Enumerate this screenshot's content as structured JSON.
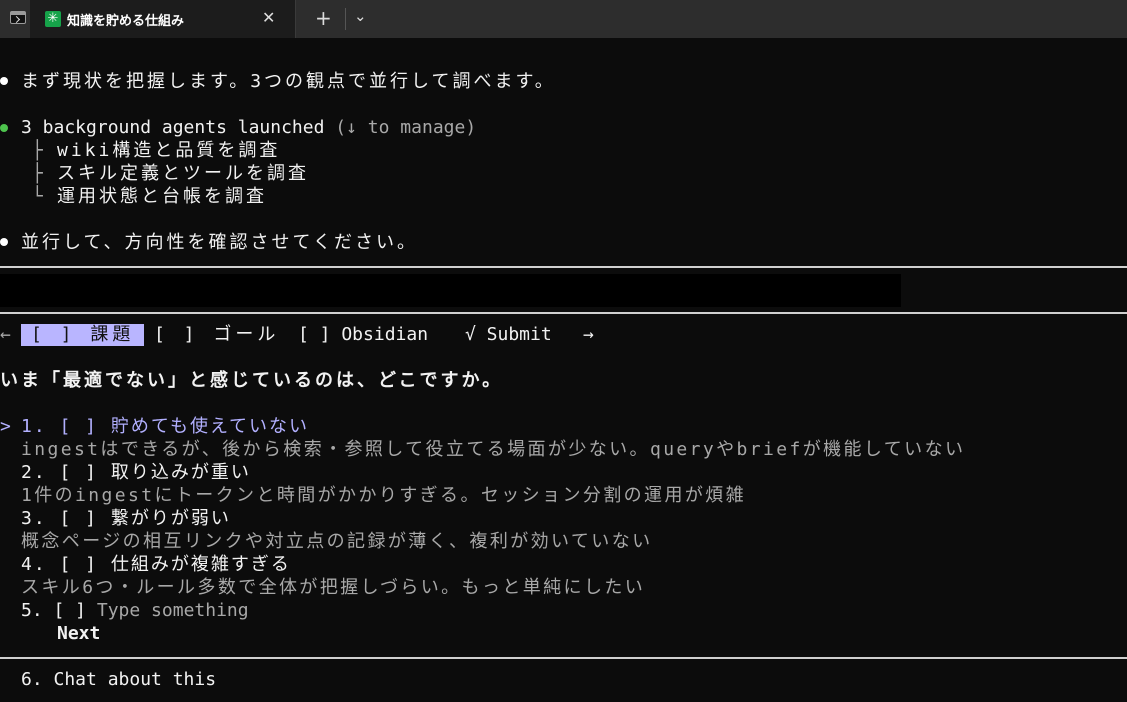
{
  "window": {
    "tab_title": "知識を貯める仕組み",
    "tab_close": "✕",
    "new_tab": "+",
    "dropdown": "⌄",
    "app_icon_glyph": "✳",
    "app_icon_color": "#16a34a"
  },
  "log": {
    "line1": "まず現状を把握します。3つの観点で並行して調べます。",
    "agents_summary": "3 background agents launched",
    "agents_hint": "(↓ to manage)",
    "agent_tree": "├",
    "agent_tree_last": "└",
    "agents": [
      "wiki構造と品質を調査",
      "スキル定義とツールを調査",
      "運用状態と台帳を調査"
    ],
    "line_final": "並行して、方向性を確認させてください。",
    "bullet_white": "#ffffff",
    "bullet_green": "#4ec44e"
  },
  "question": {
    "nav_left": "←",
    "nav_right": "→",
    "tabs": [
      "[ ] 課題",
      "[ ] ゴール",
      "[ ] Obsidian",
      "√ Submit"
    ],
    "prompt": "いま「最適でない」と感じているのは、どこですか。",
    "cursor": ">",
    "options": [
      {
        "label": "1. [ ] 貯めても使えていない",
        "desc": "ingestはできるが、後から検索・参照して役立てる場面が少ない。queryやbriefが機能していない"
      },
      {
        "label": "2. [ ] 取り込みが重い",
        "desc": "1件のingestにトークンと時間がかかりすぎる。セッション分割の運用が煩雑"
      },
      {
        "label": "3. [ ] 繋がりが弱い",
        "desc": "概念ページの相互リンクや対立点の記録が薄く、複利が効いていない"
      },
      {
        "label": "4. [ ] 仕組みが複雑すぎる",
        "desc": "スキル6つ・ルール多数で全体が把握しづらい。もっと単純にしたい"
      }
    ],
    "option5_prefix": "5. [ ]",
    "option5_placeholder": "Type something",
    "next": "Next",
    "chat": "6. Chat about this"
  }
}
